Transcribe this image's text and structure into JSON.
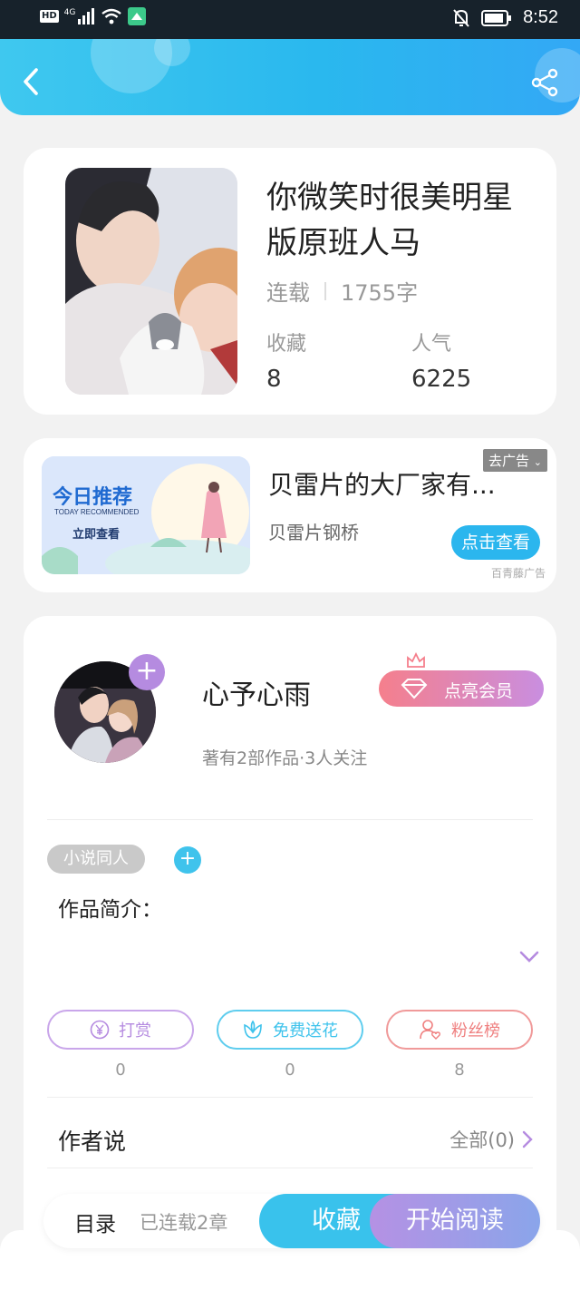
{
  "status_bar": {
    "network_badge": "HD",
    "network_type": "4G",
    "time": "8:52",
    "icons": [
      "signal-icon",
      "wifi-icon",
      "notification-app-icon",
      "mute-bell-icon",
      "battery-icon"
    ]
  },
  "header": {
    "back_icon": "chevron-left-icon",
    "share_icon": "share-icon",
    "accent_color": "#2ab8ee"
  },
  "book": {
    "title": "你微笑时很美明星版原班人马",
    "status": "连载",
    "word_count": "1755字",
    "favorites_label": "收藏",
    "favorites_value": "8",
    "popularity_label": "人气",
    "popularity_value": "6225"
  },
  "ad": {
    "image_title": "今日推荐",
    "image_subtitle": "TODAY RECOMMENDED",
    "image_button": "立即查看",
    "title": "贝雷片的大厂家有...",
    "subtitle": "贝雷片钢桥",
    "close_label": "去广告",
    "cta_label": "点击查看",
    "source": "百青藤广告"
  },
  "author": {
    "name": "心予心雨",
    "stats": "著有2部作品·3人关注",
    "vip_label": "点亮会员",
    "follow_icon": "plus-icon"
  },
  "work": {
    "tag": "小说同人",
    "intro_label": "作品简介：",
    "actions": [
      {
        "label": "打赏",
        "count": "0",
        "icon": "yen-icon",
        "color": "#b58be0"
      },
      {
        "label": "免费送花",
        "count": "0",
        "icon": "flower-icon",
        "color": "#3fc3ec"
      },
      {
        "label": "粉丝榜",
        "count": "8",
        "icon": "fan-user-icon",
        "color": "#ef7f7f"
      }
    ],
    "author_say_label": "作者说",
    "all_label": "全部(0)"
  },
  "bottom_bar": {
    "toc_label": "目录",
    "chapters_label": "已连载2章",
    "favorite_label": "收藏",
    "read_label": "开始阅读"
  }
}
